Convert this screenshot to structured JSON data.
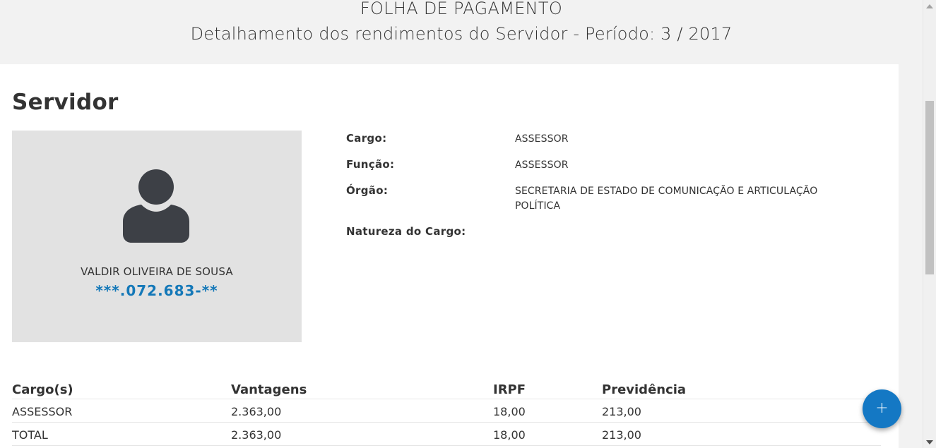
{
  "header": {
    "title": "FOLHA DE PAGAMENTO",
    "subtitle": "Detalhamento dos rendimentos do Servidor - Período: 3 / 2017"
  },
  "server": {
    "section_title": "Servidor",
    "avatar_icon": "user-silhouette-icon",
    "name": "VALDIR OLIVEIRA DE SOUSA",
    "cpf": "***.072.683-**"
  },
  "details": [
    {
      "label": "Cargo:",
      "value": "ASSESSOR"
    },
    {
      "label": "Função:",
      "value": "ASSESSOR"
    },
    {
      "label": "Órgão:",
      "value": "SECRETARIA DE ESTADO DE COMUNICAÇÃO E ARTICULAÇÃO POLÍTICA"
    },
    {
      "label": "Natureza do Cargo:",
      "value": ""
    }
  ],
  "table": {
    "headers": [
      "Cargo(s)",
      "Vantagens",
      "IRPF",
      "Previdência"
    ],
    "rows": [
      [
        "ASSESSOR",
        "2.363,00",
        "18,00",
        "213,00"
      ],
      [
        "TOTAL",
        "2.363,00",
        "18,00",
        "213,00"
      ]
    ]
  },
  "fab": {
    "label": "+",
    "icon": "plus-icon"
  },
  "colors": {
    "accent": "#1478b8",
    "fab": "#1478c4",
    "photo_bg": "#e2e2e2",
    "page_bg": "#f2f2f2"
  }
}
